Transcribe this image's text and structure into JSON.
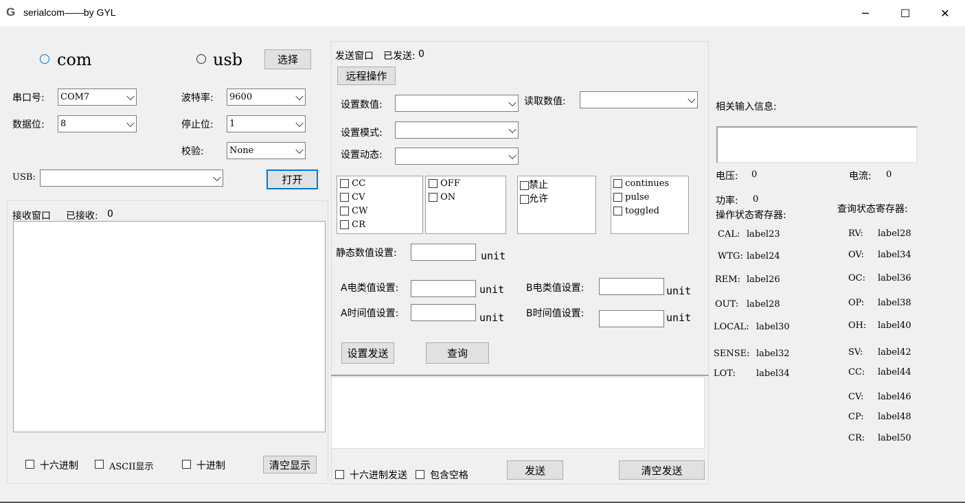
{
  "window": {
    "title": "serialcom——by GYL",
    "icon": "G",
    "min": "─",
    "max": "☐",
    "close": "✕"
  },
  "conn": {
    "com_label": "com",
    "usb_label": "usb",
    "select_btn": "选择",
    "port_label": "串口号:",
    "port_value": "COM7",
    "baud_label": "波特率:",
    "baud_value": "9600",
    "databits_label": "数据位:",
    "databits_value": "8",
    "stopbits_label": "停止位:",
    "stopbits_value": "1",
    "parity_label": "校验:",
    "parity_value": "None",
    "usb_field_label": "USB:",
    "usb_value": "",
    "open_btn": "打开"
  },
  "receive": {
    "title": "接收窗口",
    "count_label": "已接收:",
    "count_value": "0",
    "hex_label": "十六进制",
    "ascii_label": "ASCII显示",
    "dec_label": "十进制",
    "clear_btn": "清空显示"
  },
  "send": {
    "title": "发送窗口",
    "count_label": "已发送:",
    "count_value": "0",
    "remote_btn": "远程操作",
    "set_value_label": "设置数值:",
    "read_value_label": "读取数值:",
    "set_mode_label": "设置模式:",
    "set_dynamic_label": "设置动态:",
    "mode_list": [
      "CC",
      "CV",
      "CW",
      "CR"
    ],
    "state_list": [
      "OFF",
      "ON"
    ],
    "permit_list": [
      "禁止",
      "允许"
    ],
    "dyn_list": [
      "continues",
      "pulse",
      "toggled"
    ],
    "static_label": "静态数值设置:",
    "unit": "unit",
    "a_class_label": "A电类值设置:",
    "b_class_label": "B电类值设置:",
    "a_time_label": "A时间值设置:",
    "b_time_label": "B时间值设置:",
    "set_send_btn": "设置发送",
    "query_btn": "查询",
    "hex_send_label": "十六进制发送",
    "include_space_label": "包含空格",
    "send_btn": "发送",
    "clear_send_btn": "清空发送"
  },
  "info": {
    "related_label": "相关输入信息:",
    "voltage_label": "电压:",
    "voltage_value": "0",
    "current_label": "电流:",
    "current_value": "0",
    "power_label": "功率:",
    "power_value": "0",
    "op_reg_label": "操作状态寄存器:",
    "query_reg_label": "查询状态寄存器:",
    "op_regs": [
      {
        "k": "CAL:",
        "v": "label23"
      },
      {
        "k": "WTG:",
        "v": "label24"
      },
      {
        "k": "REM:",
        "v": "label26"
      },
      {
        "k": "OUT:",
        "v": "label28"
      },
      {
        "k": "LOCAL:",
        "v": "label30"
      },
      {
        "k": "SENSE:",
        "v": "label32"
      },
      {
        "k": "LOT:",
        "v": "label34"
      }
    ],
    "query_regs": [
      {
        "k": "RV:",
        "v": "label28"
      },
      {
        "k": "OV:",
        "v": "label34"
      },
      {
        "k": "OC:",
        "v": "label36"
      },
      {
        "k": "OP:",
        "v": "label38"
      },
      {
        "k": "OH:",
        "v": "label40"
      },
      {
        "k": "SV:",
        "v": "label42"
      },
      {
        "k": "CC:",
        "v": "label44"
      },
      {
        "k": "CV:",
        "v": "label46"
      },
      {
        "k": "CP:",
        "v": "label48"
      },
      {
        "k": "CR:",
        "v": "label50"
      }
    ]
  }
}
